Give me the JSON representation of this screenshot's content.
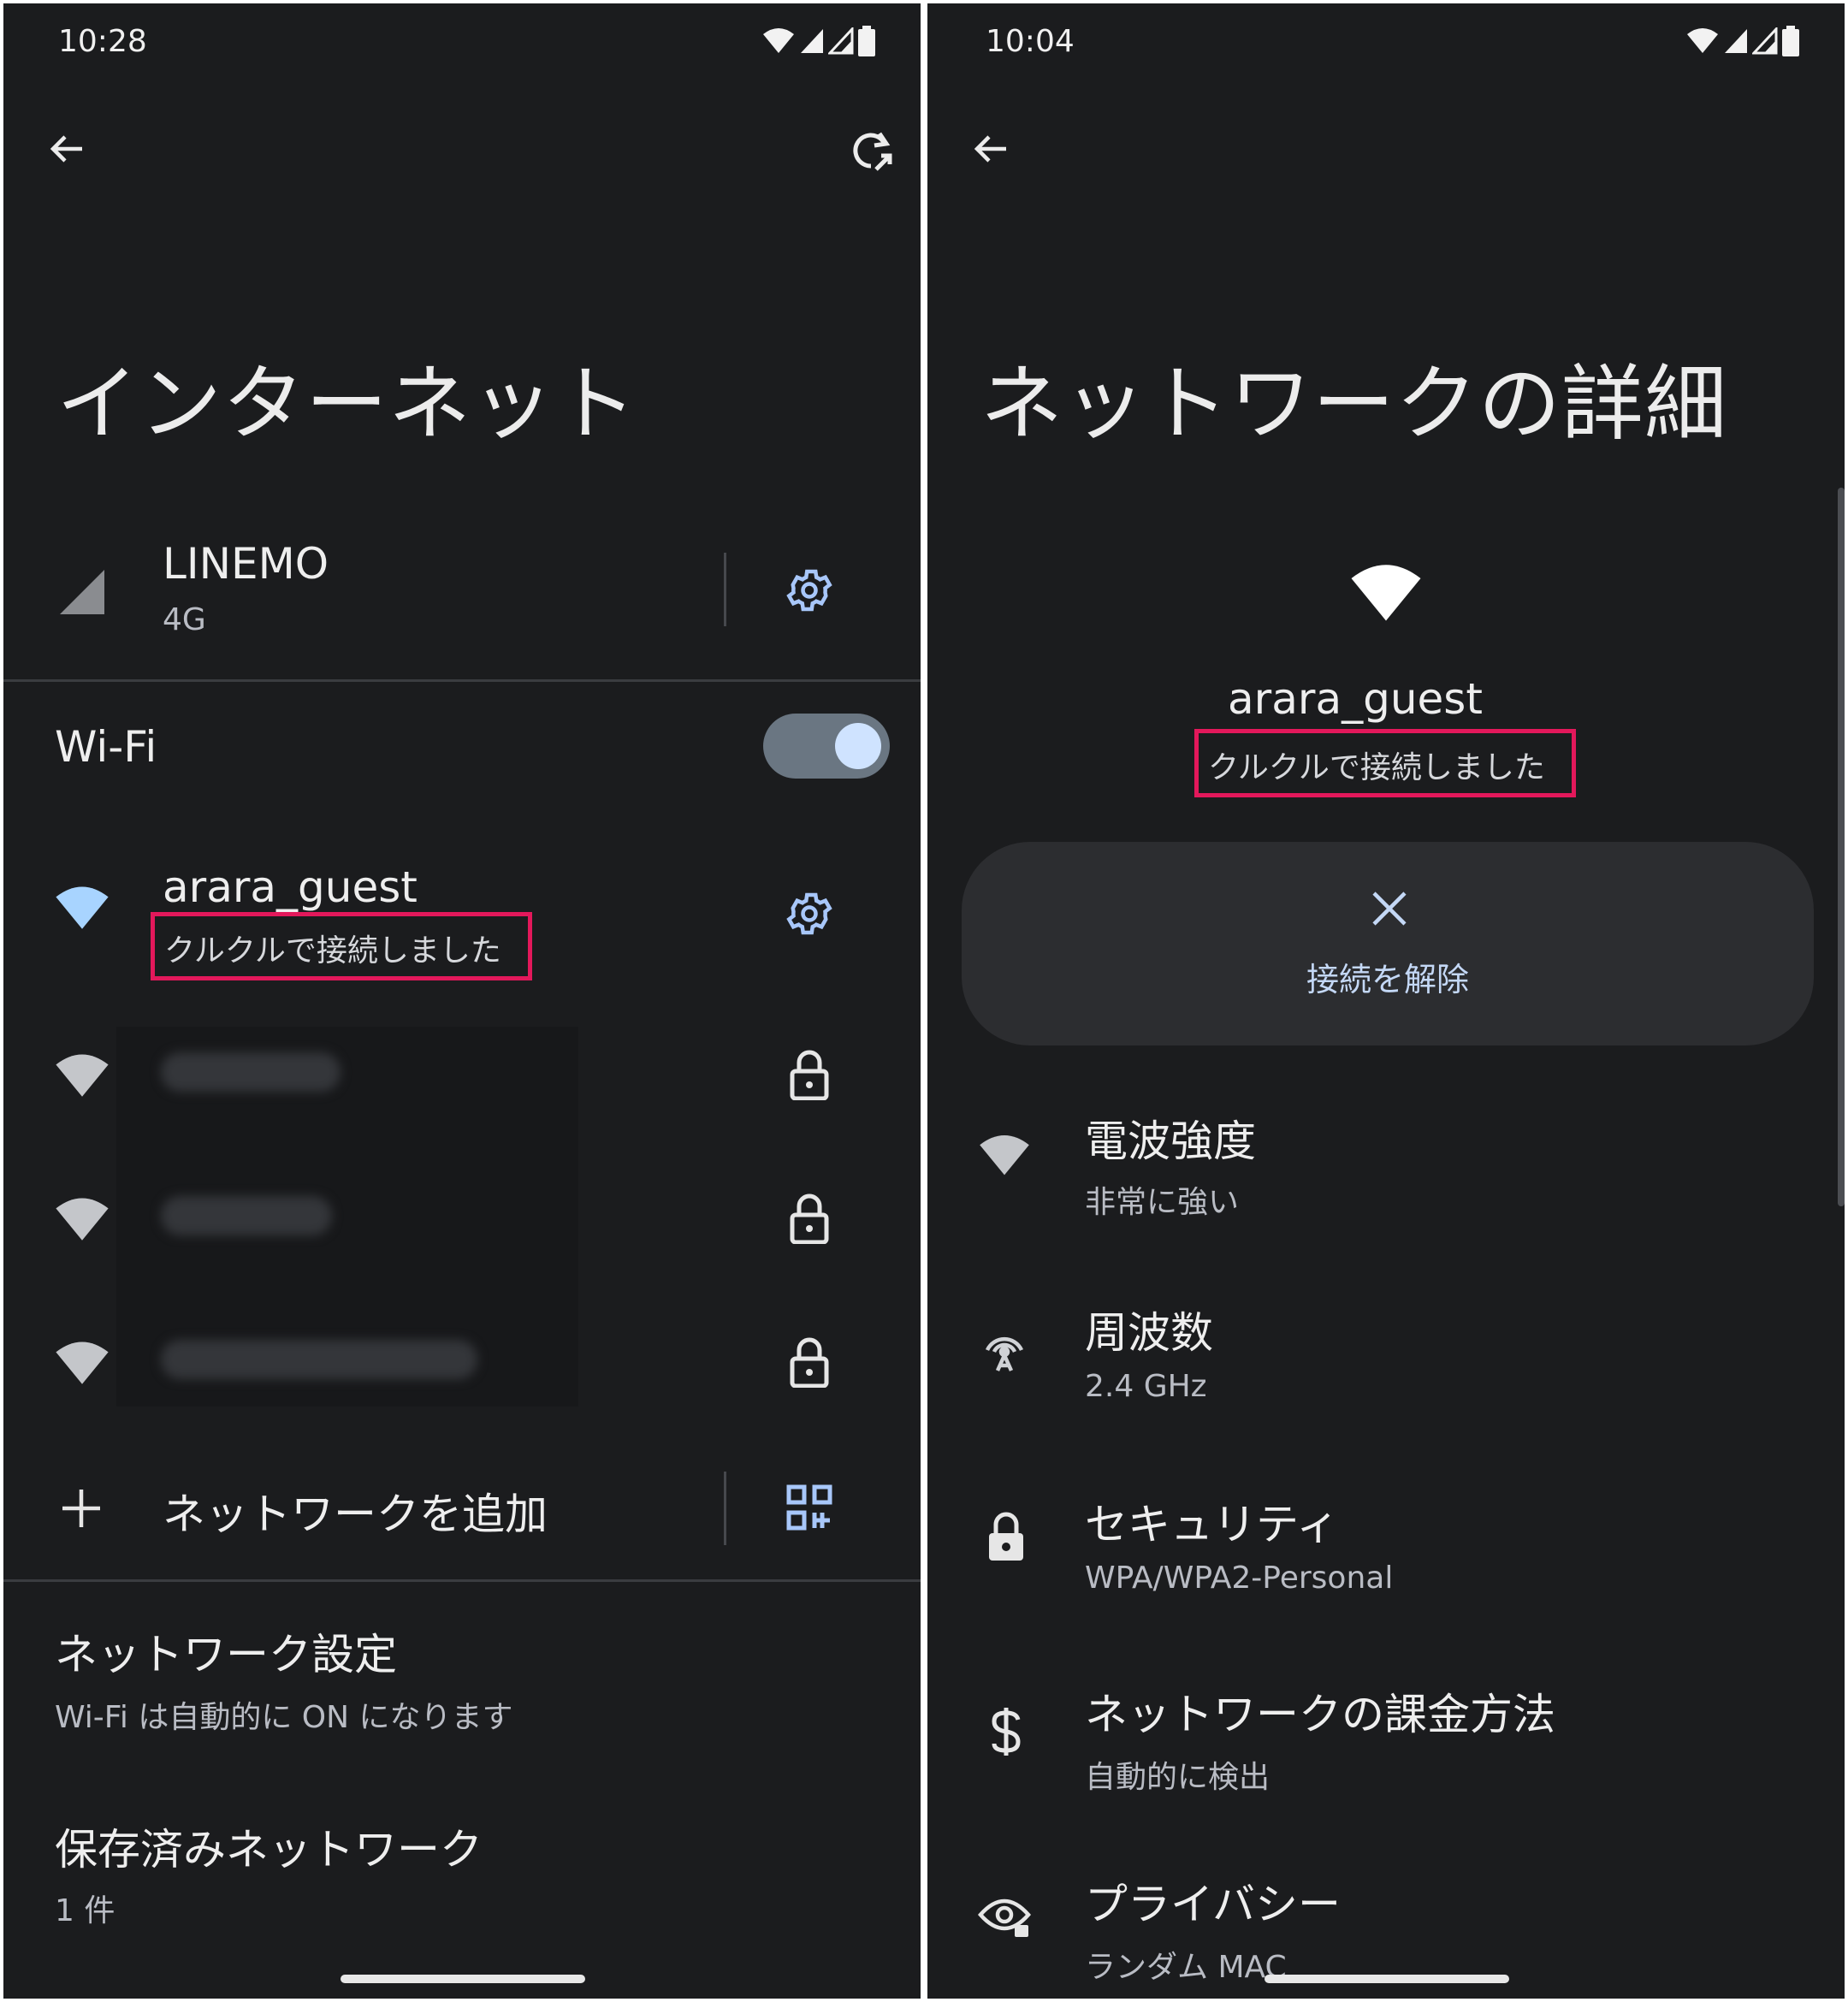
{
  "left": {
    "status": {
      "time": "10:28"
    },
    "title": "インターネット",
    "mobile": {
      "name": "LINEMO",
      "type": "4G"
    },
    "wifi": {
      "label": "Wi-Fi",
      "enabled": true
    },
    "connected": {
      "name": "arara_guest",
      "status": "クルクルで接続しました"
    },
    "add_network": "ネットワークを追加",
    "network_settings": {
      "title": "ネットワーク設定",
      "subtitle": "Wi-Fi は自動的に ON になります"
    },
    "saved_networks": {
      "title": "保存済みネットワーク",
      "count": "1 件"
    }
  },
  "right": {
    "status": {
      "time": "10:04"
    },
    "title": "ネットワークの詳細",
    "network": {
      "name": "arara_guest",
      "status": "クルクルで接続しました"
    },
    "disconnect_label": "接続を解除",
    "details": [
      {
        "title": "電波強度",
        "value": "非常に強い",
        "icon": "wifi-icon"
      },
      {
        "title": "周波数",
        "value": "2.4 GHz",
        "icon": "antenna-icon"
      },
      {
        "title": "セキュリティ",
        "value": "WPA/WPA2-Personal",
        "icon": "lock-icon"
      },
      {
        "title": "ネットワークの課金方法",
        "value": "自動的に検出",
        "icon": "dollar-icon"
      },
      {
        "title": "プライバシー",
        "value": "ランダム MAC",
        "icon": "privacy-eye-icon"
      }
    ]
  },
  "colors": {
    "background": "#1b1c1e",
    "accent": "#c4d8f6",
    "highlight": "#e3185b",
    "toggle_track": "#6a7682"
  }
}
